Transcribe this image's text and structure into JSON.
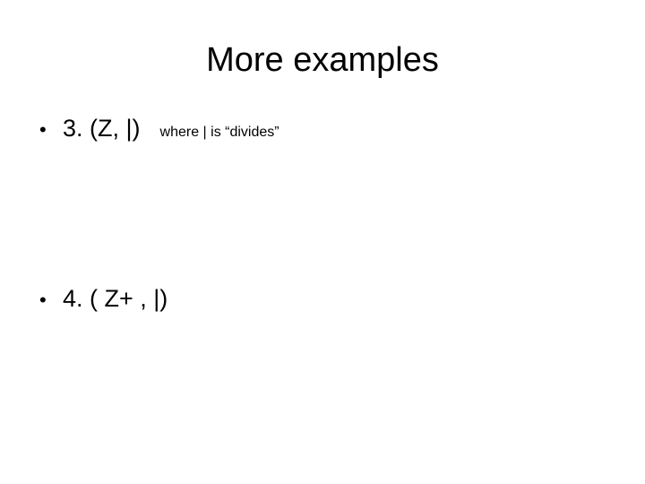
{
  "slide": {
    "title": "More examples",
    "bullets": [
      {
        "marker": "•",
        "text": "3. (Z, |)",
        "note": "where | is “divides”"
      },
      {
        "marker": "•",
        "text": "4. ( Z+ , |)",
        "note": ""
      }
    ]
  }
}
